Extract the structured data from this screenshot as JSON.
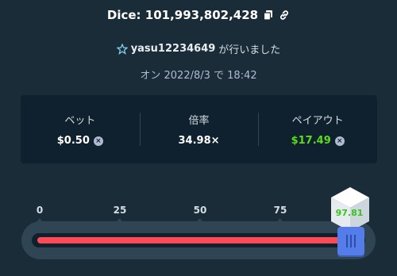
{
  "header": {
    "title": "Dice: 101,993,802,428",
    "icons": [
      "copy-icon",
      "link-icon"
    ]
  },
  "user": {
    "icon": "vip-star-icon",
    "name": "yasu12234649",
    "suffix": "が行いました"
  },
  "date": "オン 2022/8/3 で 18:42",
  "stats": [
    {
      "label": "ベット",
      "value": "$0.50",
      "color": "#ffffff",
      "coin_icon": "coin-icon"
    },
    {
      "label": "倍率",
      "value": "34.98×",
      "color": "#ffffff"
    },
    {
      "label": "ペイアウト",
      "value": "$17.49",
      "color": "#5ddb1c",
      "coin_icon": "coin-icon"
    }
  ],
  "slider": {
    "ticks": [
      "0",
      "25",
      "50",
      "75"
    ],
    "value": 97.14,
    "result": "97.81",
    "colors": {
      "under": "#ff4a55",
      "over": "#1fff20",
      "handle": "#557dea",
      "result": "#3ac21e"
    }
  }
}
